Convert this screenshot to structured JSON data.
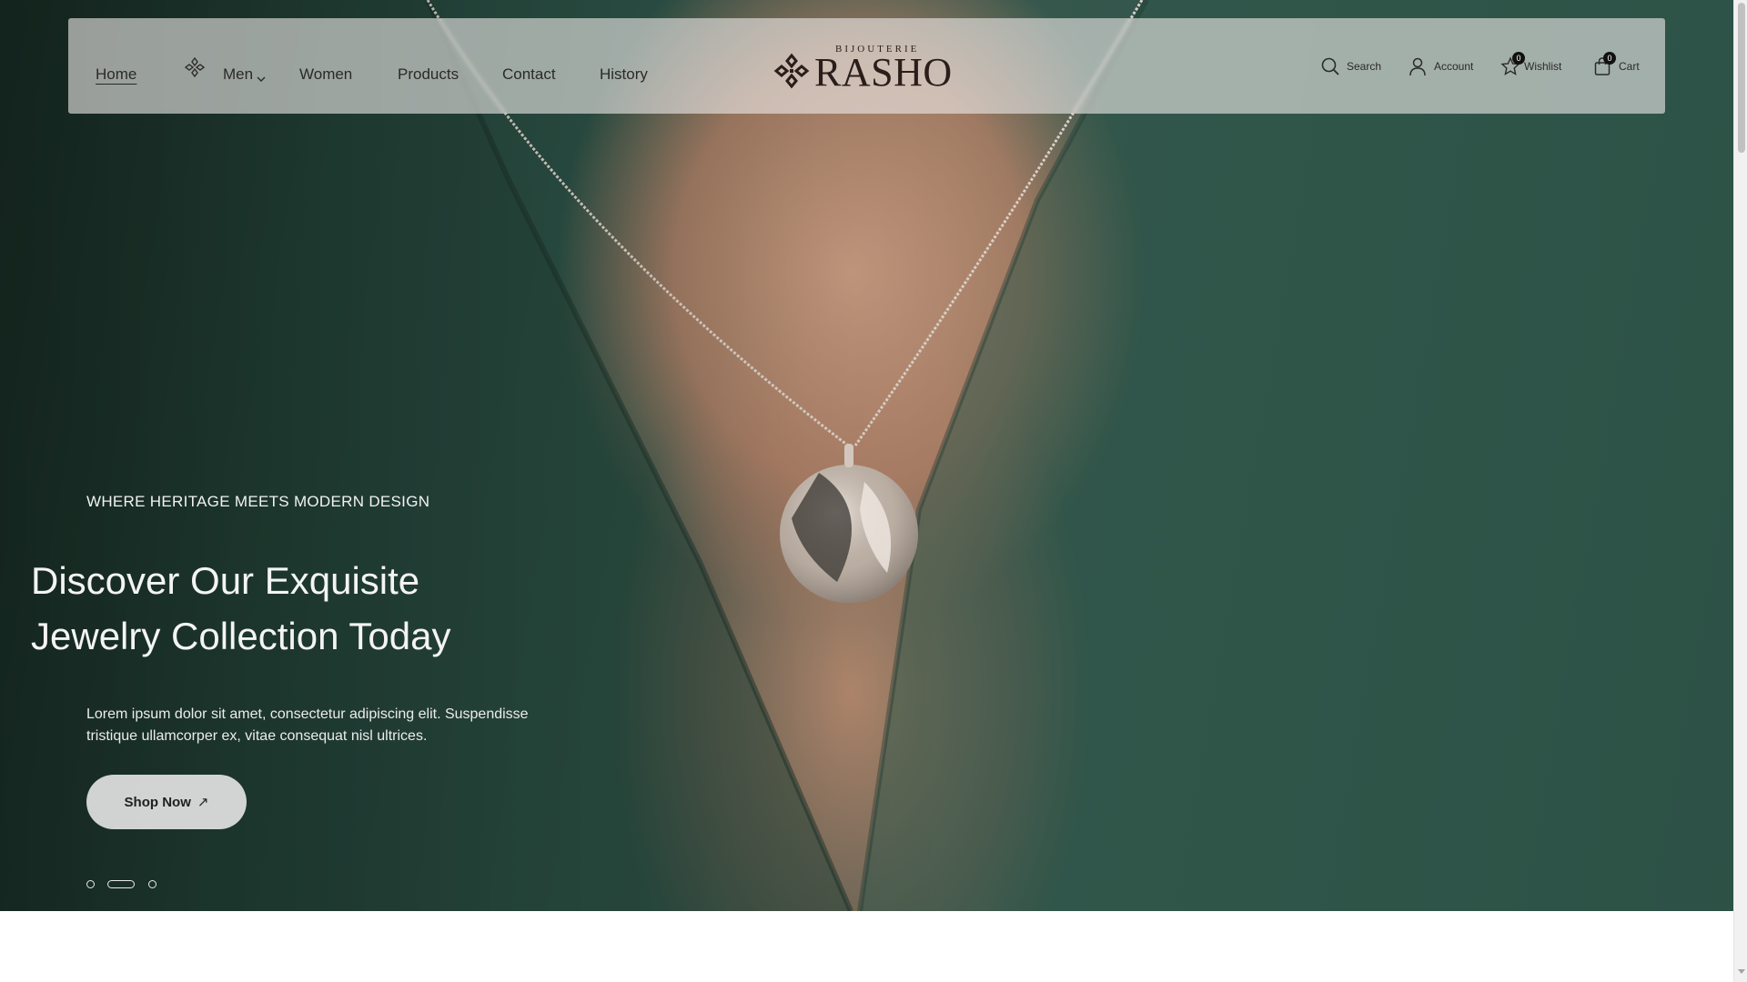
{
  "header": {
    "nav": [
      {
        "label": "Home",
        "active": true
      },
      {
        "label": "Men",
        "has_dropdown": true,
        "icon": "diamond-flower-icon"
      },
      {
        "label": "Women"
      },
      {
        "label": "Products"
      },
      {
        "label": "Contact"
      },
      {
        "label": "History"
      }
    ],
    "logo": {
      "top_text": "BIJOUTERIE",
      "main_text": "RASHO"
    },
    "utilities": {
      "search_label": "Search",
      "account_label": "Account",
      "wishlist_label": "Wishlist",
      "wishlist_count": "0",
      "cart_label": "Cart",
      "cart_count": "0"
    }
  },
  "hero": {
    "eyebrow": "WHERE HERITAGE MEETS MODERN DESIGN",
    "headline_line1": "Discover Our Exquisite",
    "headline_line2": "Jewelry Collection Today",
    "description": "Lorem ipsum dolor sit amet, consectetur adipiscing elit. Suspendisse tristique ullamcorper ex, vitae consequat nisl ultrices.",
    "button_label": "Shop Now",
    "button_icon": "arrow-up-right-icon",
    "slides_total": 3,
    "active_slide": 2
  },
  "colors": {
    "text_dark": "#2a2a2a",
    "hero_green": "#2d5247",
    "logo_brown": "#2a1e1a"
  }
}
